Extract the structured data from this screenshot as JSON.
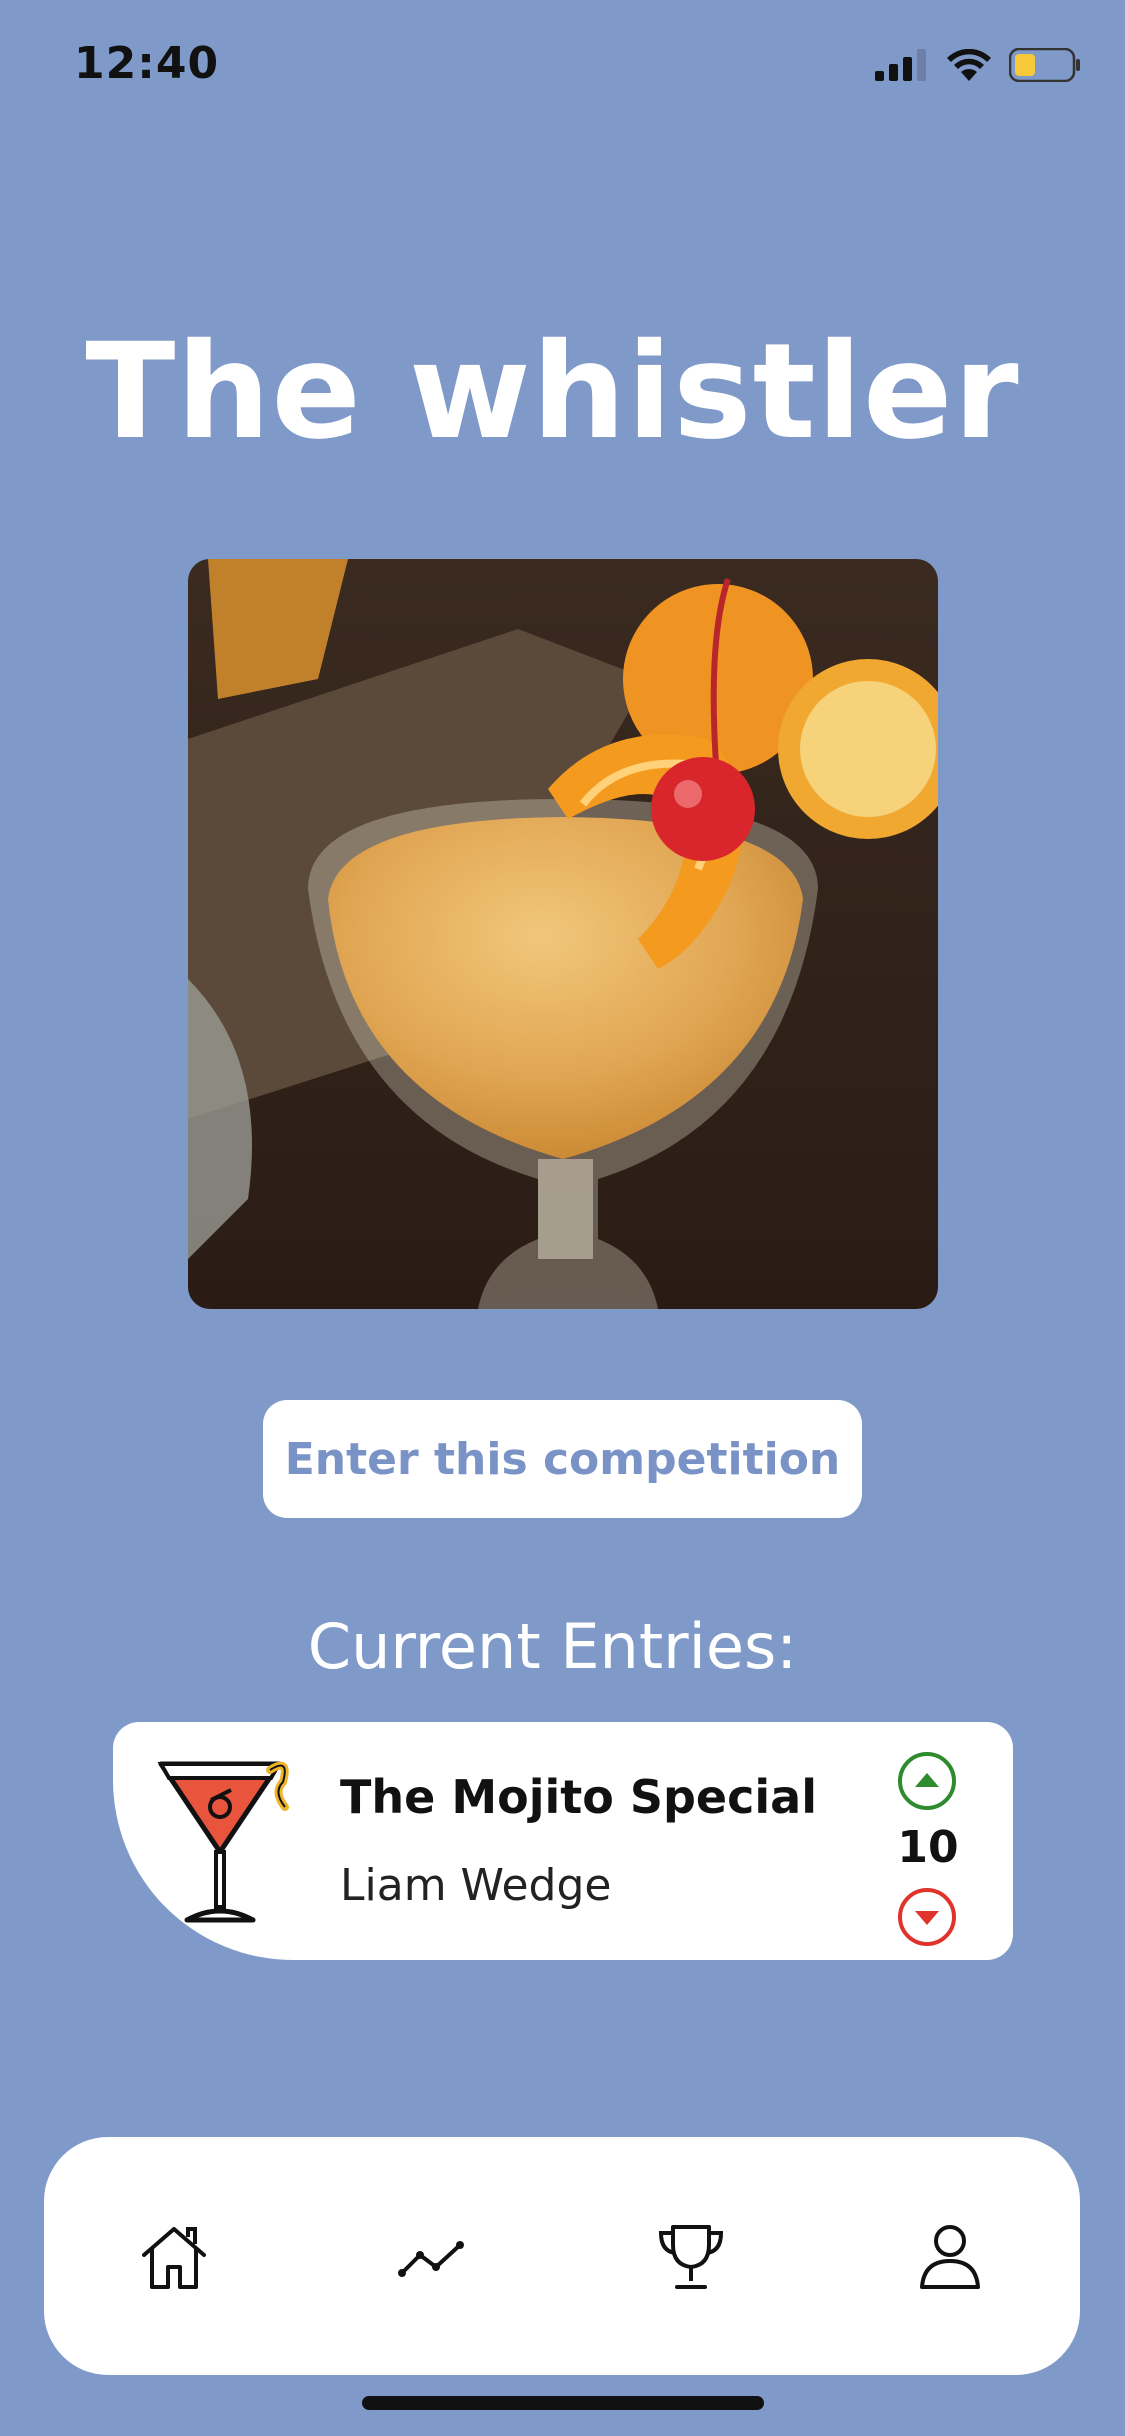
{
  "status_bar": {
    "time": "12:40",
    "icons": [
      "signal-icon",
      "wifi-icon",
      "battery-icon"
    ],
    "battery_color": "#f5c93a"
  },
  "competition": {
    "title": "The whistler",
    "image": "whiskey-sour-cocktail-photo",
    "enter_button_label": "Enter this competition"
  },
  "entries": {
    "heading": "Current Entries:",
    "items": [
      {
        "name": "The Mojito Special",
        "author": "Liam Wedge",
        "votes": "10",
        "icon": "cocktail-glass-icon"
      }
    ]
  },
  "tab_bar": {
    "tabs": [
      "home-icon",
      "stats-icon",
      "trophy-icon",
      "profile-icon"
    ]
  },
  "colors": {
    "background": "#7f9ac8",
    "button_text": "#7a93c6",
    "upvote": "#2e8b2e",
    "downvote": "#e0332b"
  }
}
